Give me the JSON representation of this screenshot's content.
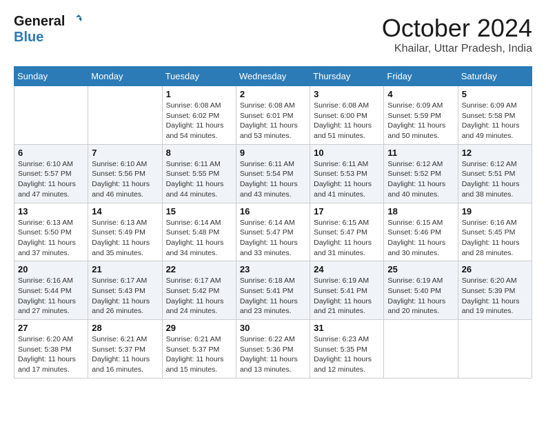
{
  "header": {
    "logo_line1": "General",
    "logo_line2": "Blue",
    "month_title": "October 2024",
    "location": "Khailar, Uttar Pradesh, India"
  },
  "weekdays": [
    "Sunday",
    "Monday",
    "Tuesday",
    "Wednesday",
    "Thursday",
    "Friday",
    "Saturday"
  ],
  "weeks": [
    [
      {
        "day": "",
        "info": ""
      },
      {
        "day": "",
        "info": ""
      },
      {
        "day": "1",
        "info": "Sunrise: 6:08 AM\nSunset: 6:02 PM\nDaylight: 11 hours and 54 minutes."
      },
      {
        "day": "2",
        "info": "Sunrise: 6:08 AM\nSunset: 6:01 PM\nDaylight: 11 hours and 53 minutes."
      },
      {
        "day": "3",
        "info": "Sunrise: 6:08 AM\nSunset: 6:00 PM\nDaylight: 11 hours and 51 minutes."
      },
      {
        "day": "4",
        "info": "Sunrise: 6:09 AM\nSunset: 5:59 PM\nDaylight: 11 hours and 50 minutes."
      },
      {
        "day": "5",
        "info": "Sunrise: 6:09 AM\nSunset: 5:58 PM\nDaylight: 11 hours and 49 minutes."
      }
    ],
    [
      {
        "day": "6",
        "info": "Sunrise: 6:10 AM\nSunset: 5:57 PM\nDaylight: 11 hours and 47 minutes."
      },
      {
        "day": "7",
        "info": "Sunrise: 6:10 AM\nSunset: 5:56 PM\nDaylight: 11 hours and 46 minutes."
      },
      {
        "day": "8",
        "info": "Sunrise: 6:11 AM\nSunset: 5:55 PM\nDaylight: 11 hours and 44 minutes."
      },
      {
        "day": "9",
        "info": "Sunrise: 6:11 AM\nSunset: 5:54 PM\nDaylight: 11 hours and 43 minutes."
      },
      {
        "day": "10",
        "info": "Sunrise: 6:11 AM\nSunset: 5:53 PM\nDaylight: 11 hours and 41 minutes."
      },
      {
        "day": "11",
        "info": "Sunrise: 6:12 AM\nSunset: 5:52 PM\nDaylight: 11 hours and 40 minutes."
      },
      {
        "day": "12",
        "info": "Sunrise: 6:12 AM\nSunset: 5:51 PM\nDaylight: 11 hours and 38 minutes."
      }
    ],
    [
      {
        "day": "13",
        "info": "Sunrise: 6:13 AM\nSunset: 5:50 PM\nDaylight: 11 hours and 37 minutes."
      },
      {
        "day": "14",
        "info": "Sunrise: 6:13 AM\nSunset: 5:49 PM\nDaylight: 11 hours and 35 minutes."
      },
      {
        "day": "15",
        "info": "Sunrise: 6:14 AM\nSunset: 5:48 PM\nDaylight: 11 hours and 34 minutes."
      },
      {
        "day": "16",
        "info": "Sunrise: 6:14 AM\nSunset: 5:47 PM\nDaylight: 11 hours and 33 minutes."
      },
      {
        "day": "17",
        "info": "Sunrise: 6:15 AM\nSunset: 5:47 PM\nDaylight: 11 hours and 31 minutes."
      },
      {
        "day": "18",
        "info": "Sunrise: 6:15 AM\nSunset: 5:46 PM\nDaylight: 11 hours and 30 minutes."
      },
      {
        "day": "19",
        "info": "Sunrise: 6:16 AM\nSunset: 5:45 PM\nDaylight: 11 hours and 28 minutes."
      }
    ],
    [
      {
        "day": "20",
        "info": "Sunrise: 6:16 AM\nSunset: 5:44 PM\nDaylight: 11 hours and 27 minutes."
      },
      {
        "day": "21",
        "info": "Sunrise: 6:17 AM\nSunset: 5:43 PM\nDaylight: 11 hours and 26 minutes."
      },
      {
        "day": "22",
        "info": "Sunrise: 6:17 AM\nSunset: 5:42 PM\nDaylight: 11 hours and 24 minutes."
      },
      {
        "day": "23",
        "info": "Sunrise: 6:18 AM\nSunset: 5:41 PM\nDaylight: 11 hours and 23 minutes."
      },
      {
        "day": "24",
        "info": "Sunrise: 6:19 AM\nSunset: 5:41 PM\nDaylight: 11 hours and 21 minutes."
      },
      {
        "day": "25",
        "info": "Sunrise: 6:19 AM\nSunset: 5:40 PM\nDaylight: 11 hours and 20 minutes."
      },
      {
        "day": "26",
        "info": "Sunrise: 6:20 AM\nSunset: 5:39 PM\nDaylight: 11 hours and 19 minutes."
      }
    ],
    [
      {
        "day": "27",
        "info": "Sunrise: 6:20 AM\nSunset: 5:38 PM\nDaylight: 11 hours and 17 minutes."
      },
      {
        "day": "28",
        "info": "Sunrise: 6:21 AM\nSunset: 5:37 PM\nDaylight: 11 hours and 16 minutes."
      },
      {
        "day": "29",
        "info": "Sunrise: 6:21 AM\nSunset: 5:37 PM\nDaylight: 11 hours and 15 minutes."
      },
      {
        "day": "30",
        "info": "Sunrise: 6:22 AM\nSunset: 5:36 PM\nDaylight: 11 hours and 13 minutes."
      },
      {
        "day": "31",
        "info": "Sunrise: 6:23 AM\nSunset: 5:35 PM\nDaylight: 11 hours and 12 minutes."
      },
      {
        "day": "",
        "info": ""
      },
      {
        "day": "",
        "info": ""
      }
    ]
  ]
}
